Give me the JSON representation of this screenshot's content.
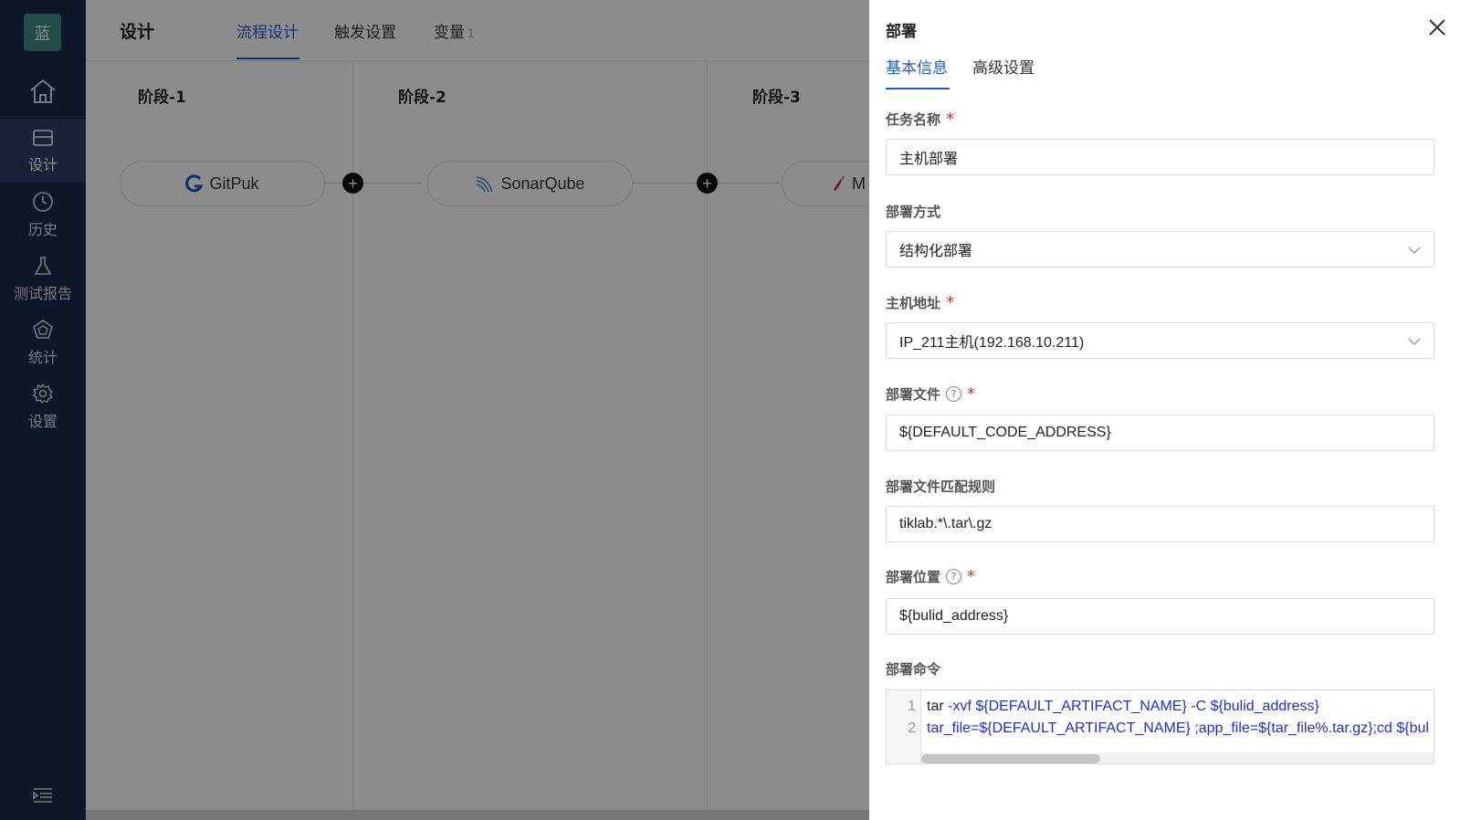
{
  "nav": {
    "logo": "蓝",
    "items": [
      {
        "label": "设计",
        "icon": "design-icon",
        "active": true
      },
      {
        "label": "历史",
        "icon": "clock-icon"
      },
      {
        "label": "测试报告",
        "icon": "flask-icon"
      },
      {
        "label": "统计",
        "icon": "stats-icon"
      },
      {
        "label": "设置",
        "icon": "gear-icon"
      }
    ]
  },
  "header": {
    "title": "设计",
    "tabs": [
      {
        "label": "流程设计",
        "active": true
      },
      {
        "label": "触发设置"
      },
      {
        "label": "变量",
        "count": "1"
      }
    ]
  },
  "stages": [
    {
      "title": "阶段-1",
      "task": "GitPuk"
    },
    {
      "title": "阶段-2",
      "task": "SonarQube"
    },
    {
      "title": "阶段-3",
      "task": "M"
    }
  ],
  "drawer": {
    "title": "部署",
    "tabs": [
      {
        "label": "基本信息",
        "active": true
      },
      {
        "label": "高级设置"
      }
    ],
    "fields": {
      "task_name": {
        "label": "任务名称",
        "value": "主机部署"
      },
      "deploy_mode": {
        "label": "部署方式",
        "value": "结构化部署"
      },
      "host": {
        "label": "主机地址",
        "value": "IP_211主机(192.168.10.211)"
      },
      "deploy_file": {
        "label": "部署文件",
        "value": "${DEFAULT_CODE_ADDRESS}"
      },
      "file_rule": {
        "label": "部署文件匹配规则",
        "value": "tiklab.*\\.tar\\.gz"
      },
      "location": {
        "label": "部署位置",
        "value": "${bulid_address}"
      },
      "command": {
        "label": "部署命令",
        "lines": [
          {
            "num": "1",
            "cmd": "tar",
            "rest": " -xvf  ${DEFAULT_ARTIFACT_NAME} -C ${bulid_address}"
          },
          {
            "num": "2",
            "cmd": "",
            "rest": "tar_file=${DEFAULT_ARTIFACT_NAME} ;app_file=${tar_file%.tar.gz};cd ${bul"
          }
        ]
      }
    }
  },
  "colors": {
    "accent": "#1d5bd6",
    "nav_bg": "#1b2a4d",
    "required": "#e0312a"
  }
}
